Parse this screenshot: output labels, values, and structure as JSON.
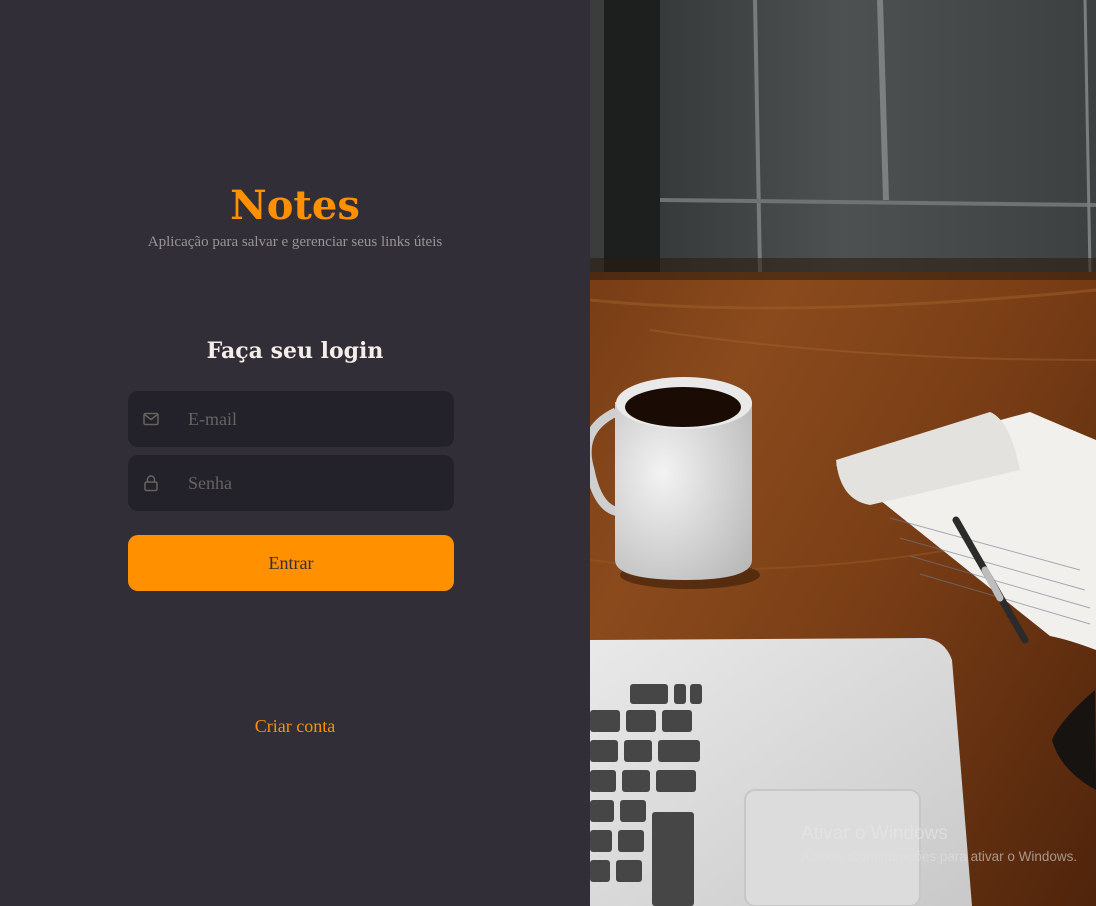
{
  "app": {
    "title": "Notes",
    "tagline": "Aplicação para salvar e gerenciar seus links úteis"
  },
  "login": {
    "heading": "Faça seu login",
    "email_placeholder": "E-mail",
    "email_icon": "mail-icon",
    "password_placeholder": "Senha",
    "password_icon": "lock-icon",
    "submit_label": "Entrar",
    "create_account_label": "Criar conta"
  },
  "background_image": {
    "subject": "coffee mug, rolled notebook with pen, laptop on wooden desk"
  },
  "os_watermark": {
    "title": "Ativar o Windows",
    "subtitle": "Acesse Configurações para ativar o Windows."
  },
  "colors": {
    "background": "#312e38",
    "input_background": "#232129",
    "accent": "#ff9000",
    "heading_text": "#f4ede8",
    "muted_text": "#999591",
    "placeholder_text": "#666360"
  }
}
